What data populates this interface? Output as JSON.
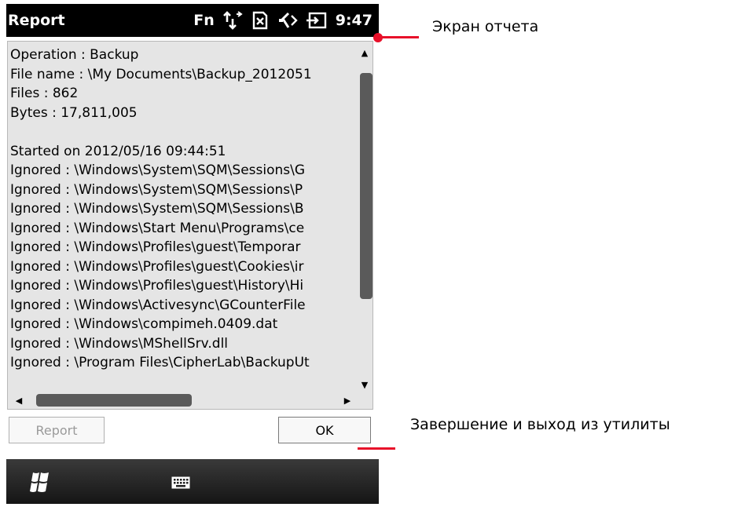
{
  "window": {
    "title": "Report",
    "status_fn": "Fn",
    "clock": "9:47"
  },
  "report": {
    "lines": [
      "Operation : Backup",
      "File name : \\My Documents\\Backup_2012051",
      "Files : 862",
      "Bytes : 17,811,005",
      "",
      "Started on 2012/05/16 09:44:51",
      "Ignored : \\Windows\\System\\SQM\\Sessions\\G",
      "Ignored : \\Windows\\System\\SQM\\Sessions\\P",
      "Ignored : \\Windows\\System\\SQM\\Sessions\\B",
      "Ignored : \\Windows\\Start Menu\\Programs\\ce",
      "Ignored : \\Windows\\Profiles\\guest\\Temporar",
      "Ignored : \\Windows\\Profiles\\guest\\Cookies\\ir",
      "Ignored : \\Windows\\Profiles\\guest\\History\\Hi",
      "Ignored : \\Windows\\Activesync\\GCounterFile",
      "Ignored : \\Windows\\compimeh.0409.dat",
      "Ignored : \\Windows\\MShellSrv.dll",
      "Ignored : \\Program Files\\CipherLab\\BackupUt"
    ]
  },
  "buttons": {
    "report_label": "Report",
    "ok_label": "OK"
  },
  "annotations": {
    "report_screen": "Экран отчета",
    "finish_exit": "Завершение и выход из утилиты"
  },
  "icons": {
    "status": [
      "connectivity-arrows-icon",
      "no-sim-icon",
      "speaker-muted-icon",
      "battery-charging-icon"
    ],
    "softbar": [
      "windows-start-icon",
      "keyboard-icon"
    ]
  },
  "colors": {
    "callout": "#e8102a",
    "titlebar": "#000000",
    "textarea_bg": "#e5e5e5",
    "scroll_thumb": "#5a5a5a"
  }
}
